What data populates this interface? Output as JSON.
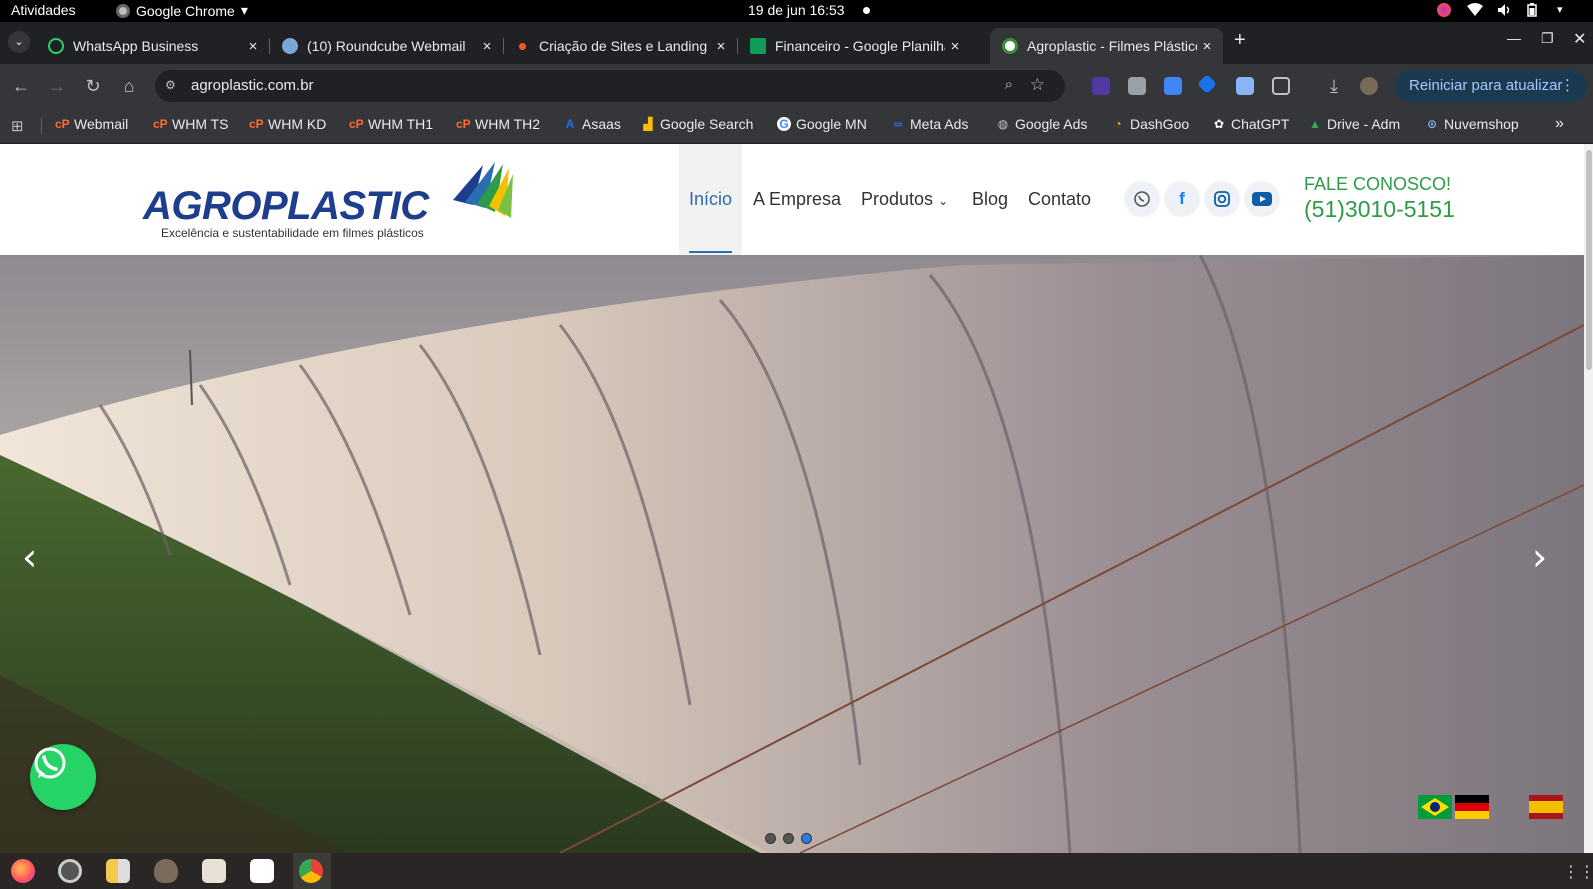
{
  "system_bar": {
    "activities": "Atividades",
    "app_name": "Google Chrome",
    "clock": "19 de jun  16:53"
  },
  "tabs": [
    {
      "label": "WhatsApp Business",
      "icon": "whatsapp-icon",
      "color": "#25d366"
    },
    {
      "label": "(10) Roundcube Webmail",
      "icon": "roundcube-icon",
      "color": "#7aa7d6"
    },
    {
      "label": "Criação de Sites e Landing",
      "icon": "dot-icon",
      "color": "#ff5722"
    },
    {
      "label": "Financeiro - Google Planilhas",
      "icon": "sheets-icon",
      "color": "#0f9d58"
    },
    {
      "label": "Agroplastic - Filmes Plásticos",
      "icon": "agroplastic-favicon",
      "color": "#ffffff"
    }
  ],
  "toolbar": {
    "url": "agroplastic.com.br",
    "update_button": "Reiniciar para atualizar"
  },
  "bookmarks": [
    {
      "label": "Webmail",
      "icon": "cpanel-icon",
      "color": "#ff6c2c"
    },
    {
      "label": "WHM TS",
      "icon": "cpanel-icon",
      "color": "#ff6c2c"
    },
    {
      "label": "WHM KD",
      "icon": "cpanel-icon",
      "color": "#ff6c2c"
    },
    {
      "label": "WHM TH1",
      "icon": "cpanel-icon",
      "color": "#ff6c2c"
    },
    {
      "label": "WHM TH2",
      "icon": "cpanel-icon",
      "color": "#ff6c2c"
    },
    {
      "label": "Asaas",
      "icon": "asaas-icon",
      "color": "#1a73e8"
    },
    {
      "label": "Google Search",
      "icon": "chart-icon",
      "color": "#fbbc04"
    },
    {
      "label": "Google MN",
      "icon": "google-icon",
      "color": "#ffffff"
    },
    {
      "label": "Meta Ads",
      "icon": "meta-icon",
      "color": "#1877f2"
    },
    {
      "label": "Google Ads",
      "icon": "globe-icon",
      "color": "#bdc1c6"
    },
    {
      "label": "DashGoo",
      "icon": "dashgoo-icon",
      "color": "#f4b400"
    },
    {
      "label": "ChatGPT",
      "icon": "chatgpt-icon",
      "color": "#ffffff"
    },
    {
      "label": "Drive - Adm",
      "icon": "drive-icon",
      "color": "#34a853"
    },
    {
      "label": "Nuvemshop",
      "icon": "nuvemshop-icon",
      "color": "#8ab4f8"
    }
  ],
  "site": {
    "logo_text": "AGROPLASTIC",
    "tagline": "Excelência e sustentabilidade em filmes plásticos",
    "nav": [
      "Início",
      "A Empresa",
      "Produtos",
      "Blog",
      "Contato"
    ],
    "contact_label": "FALE CONOSCO!",
    "contact_phone": "(51)3010-5151",
    "brand_blue": "#1d3e8c",
    "accent_green": "#2e9b47"
  },
  "slider": {
    "total_slides": 3,
    "active_slide": 3
  }
}
